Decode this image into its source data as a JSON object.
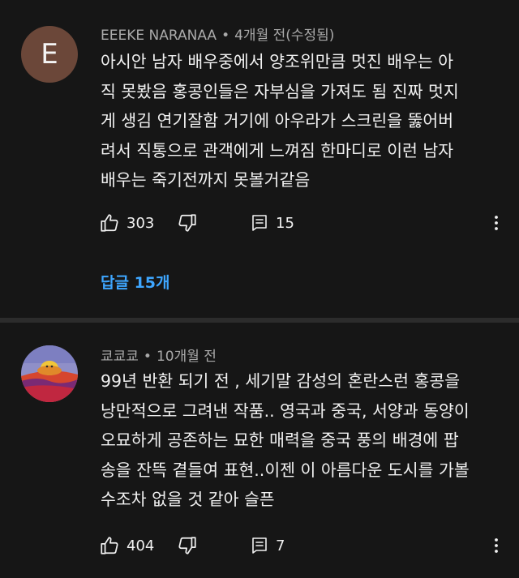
{
  "comments": [
    {
      "avatar_letter": "E",
      "avatar_color": "#6b4739",
      "author": "EEEKE NARANAA",
      "separator": "•",
      "time": "4개월 전(수정됨)",
      "text_lines": [
        "아시안 남자 배우중에서 양조위만큼 멋진 배우는 아",
        "직 못봤음 홍콩인들은 자부심을 가져도 됨 진짜 멋지",
        "게 생김 연기잘함 거기에 아우라가 스크린을 뚫어버",
        "려서 직통으로 관객에게 느껴짐 한마디로 이런 남자",
        "배우는 죽기전까지 못볼거같음"
      ],
      "likes": "303",
      "reply_count": "15",
      "replies_label": "답글 15개",
      "like_icon": "thumbs-up-icon",
      "dislike_icon": "thumbs-down-icon",
      "reply_icon": "reply-icon",
      "more_icon": "more-vert-icon"
    },
    {
      "avatar_image": "cartoon-avatar",
      "author": "쿄쿄쿄",
      "separator": "•",
      "time": "10개월 전",
      "text_lines": [
        "99년 반환 되기 전 , 세기말 감성의 혼란스런 홍콩을",
        "낭만적으로 그려낸 작품.. 영국과 중국, 서양과 동양이",
        "오묘하게 공존하는 묘한 매력을 중국 풍의 배경에 팝",
        "송을 잔뜩 곁들여 표현..이젠 이 아름다운 도시를 가볼",
        "수조차 없을 것 같아 슬픈"
      ],
      "likes": "404",
      "reply_count": "7",
      "like_icon": "thumbs-up-icon",
      "dislike_icon": "thumbs-down-icon",
      "reply_icon": "reply-icon",
      "more_icon": "more-vert-icon"
    }
  ],
  "colors": {
    "background": "#161616",
    "divider": "#2c2c2c",
    "meta_text": "#aaaaaa",
    "body_text": "#f1f1f1",
    "link": "#3ea6ff"
  }
}
